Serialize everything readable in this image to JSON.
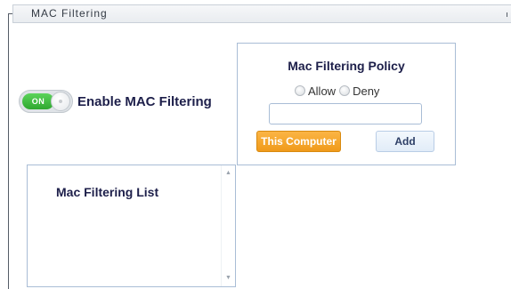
{
  "header": {
    "title": "MAC Filtering"
  },
  "toggle": {
    "state_label": "ON",
    "enabled": true,
    "label": "Enable MAC Filtering"
  },
  "policy": {
    "title": "Mac Filtering Policy",
    "options": [
      "Allow",
      "Deny"
    ],
    "mac_input_value": "",
    "this_computer_label": "This Computer",
    "add_label": "Add"
  },
  "list": {
    "title": "Mac Filtering List",
    "scroll_up_icon": "triangle-up-icon",
    "scroll_down_icon": "triangle-down-icon"
  },
  "colors": {
    "toggle_on": "#2fa82f",
    "accent_orange": "#f09a1a",
    "panel_border": "#a9bdd6",
    "heading_text": "#1d1f4a"
  }
}
